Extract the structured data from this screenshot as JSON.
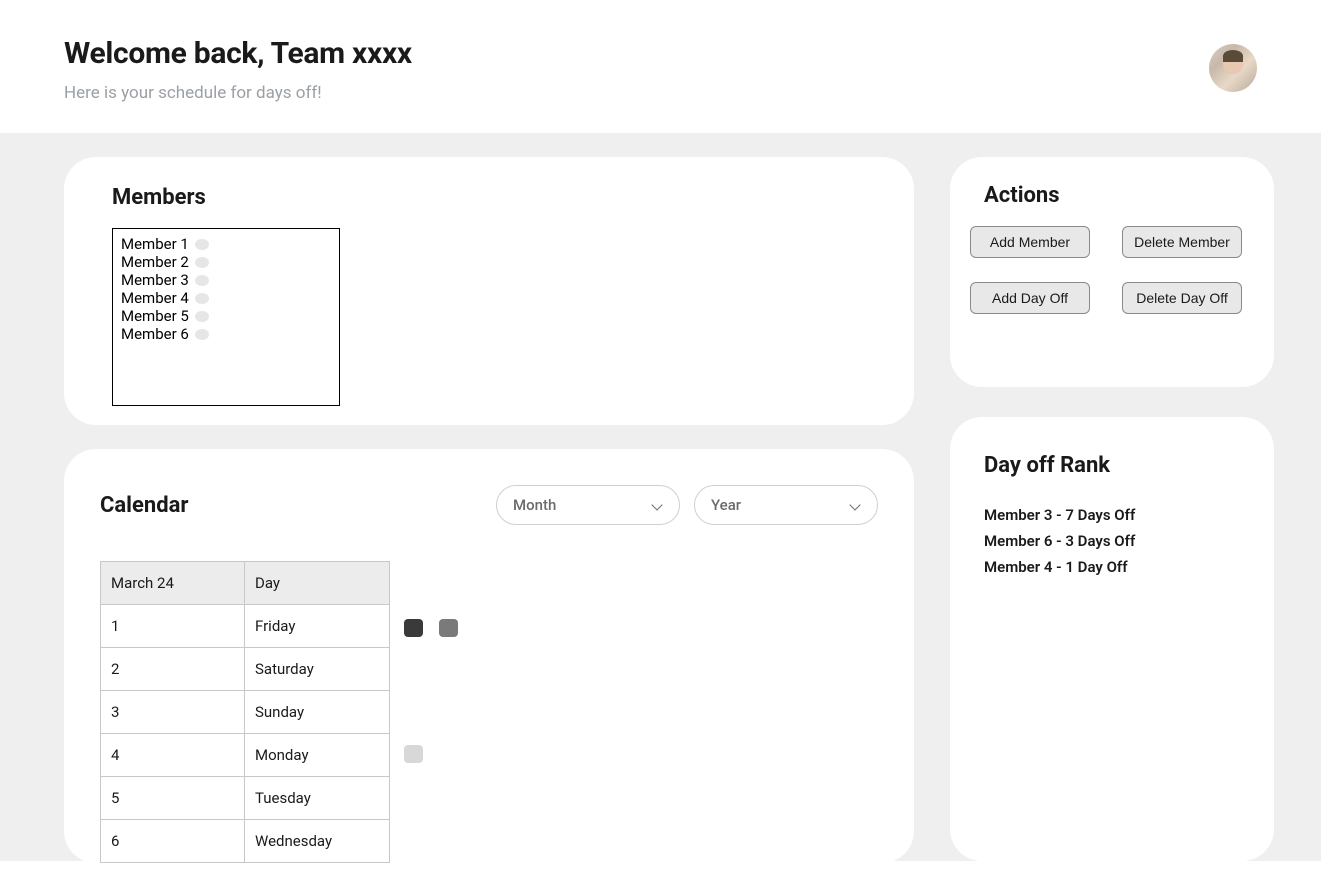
{
  "header": {
    "title": "Welcome back, Team xxxx",
    "subtitle": "Here is your schedule for days off!"
  },
  "members": {
    "title": "Members",
    "list": [
      "Member 1",
      "Member 2",
      "Member 3",
      "Member 4",
      "Member 5",
      "Member 6"
    ]
  },
  "calendar": {
    "title": "Calendar",
    "month_select": "Month",
    "year_select": "Year",
    "header_date": "March 24",
    "header_day": "Day",
    "rows": [
      {
        "num": "1",
        "day": "Friday"
      },
      {
        "num": "2",
        "day": "Saturday"
      },
      {
        "num": "3",
        "day": "Sunday"
      },
      {
        "num": "4",
        "day": "Monday"
      },
      {
        "num": "5",
        "day": "Tuesday"
      },
      {
        "num": "6",
        "day": "Wednesday"
      }
    ]
  },
  "actions": {
    "title": "Actions",
    "add_member": "Add Member",
    "delete_member": "Delete Member",
    "add_day_off": "Add Day Off",
    "delete_day_off": "Delete Day Off"
  },
  "rank": {
    "title": "Day off Rank",
    "items": [
      "Member 3  - 7 Days Off",
      "Member 6 - 3 Days Off",
      "Member 4 - 1 Day Off"
    ]
  }
}
